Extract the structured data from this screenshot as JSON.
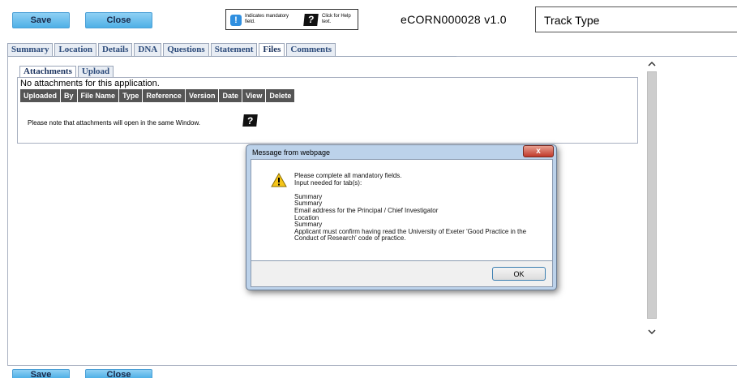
{
  "toolbar": {
    "save_label": "Save",
    "close_label": "Close"
  },
  "legend": {
    "mandatory_symbol": "!",
    "mandatory_text": "Indicates mandatory field.",
    "help_symbol": "?",
    "help_text": "Click for Help text."
  },
  "application_id": "eCORN000028 v1.0",
  "track_type": "Track Type",
  "tabs": [
    {
      "label": "Summary"
    },
    {
      "label": "Location"
    },
    {
      "label": "Details"
    },
    {
      "label": "DNA"
    },
    {
      "label": "Questions"
    },
    {
      "label": "Statement"
    },
    {
      "label": "Files"
    },
    {
      "label": "Comments"
    }
  ],
  "sub_tabs": [
    {
      "label": "Attachments"
    },
    {
      "label": "Upload"
    }
  ],
  "files": {
    "empty_text": "No attachments for this application.",
    "columns": [
      "Uploaded",
      "By",
      "File Name",
      "Type",
      "Reference",
      "Version",
      "Date",
      "View",
      "Delete"
    ],
    "note": "Please note that attachments will open in the same Window.",
    "help_symbol": "?"
  },
  "dialog": {
    "title": "Message from webpage",
    "close_symbol": "x",
    "message": "Please complete all mandatory fields.\nInput needed for tab(s):\n\nSummary\nSummary\nEmail address for the Principal / Chief Investigator\nLocation\nSummary\nApplicant must confirm having read the University of Exeter 'Good Practice in the Conduct of Research' code of practice.",
    "ok_label": "OK"
  },
  "footer": {
    "save_label": "Save",
    "close_label": "Close"
  },
  "icons": {
    "warning": "warning-icon",
    "scroll_up": "chevron-up-icon",
    "scroll_down": "chevron-down-icon"
  },
  "colors": {
    "button_blue": "#4fb0e6",
    "tab_text": "#2b4a7a",
    "header_dark": "#555555",
    "dialog_frame": "#bcd2ea"
  }
}
